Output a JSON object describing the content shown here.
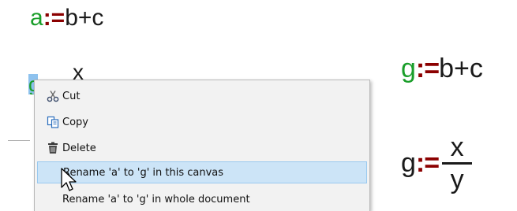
{
  "expressions": {
    "top": {
      "lhs": "a",
      "assign": ":=",
      "rhs": "b+c"
    },
    "right": {
      "lhs": "g",
      "assign": ":=",
      "rhs": "b+c"
    },
    "fraction": {
      "lhs": "g",
      "assign": ":=",
      "numerator": "x",
      "denominator": "y"
    }
  },
  "canvas": {
    "faded_numerator": "x",
    "selected_variable": "g"
  },
  "context_menu": {
    "items": [
      {
        "label": "Cut",
        "icon": "scissors-icon"
      },
      {
        "label": "Copy",
        "icon": "copy-icon"
      },
      {
        "label": "Delete",
        "icon": "trash-icon"
      },
      {
        "label": "Rename 'a' to 'g' in this canvas",
        "icon": ""
      },
      {
        "label": "Rename 'a' to 'g' in whole document",
        "icon": ""
      }
    ],
    "highlighted_index": 3
  },
  "colors": {
    "variable_green": "#1a9e2a",
    "assign_red": "#8b0000",
    "selection_blue": "#8ec2ee",
    "menu_highlight": "#cce4f7"
  }
}
